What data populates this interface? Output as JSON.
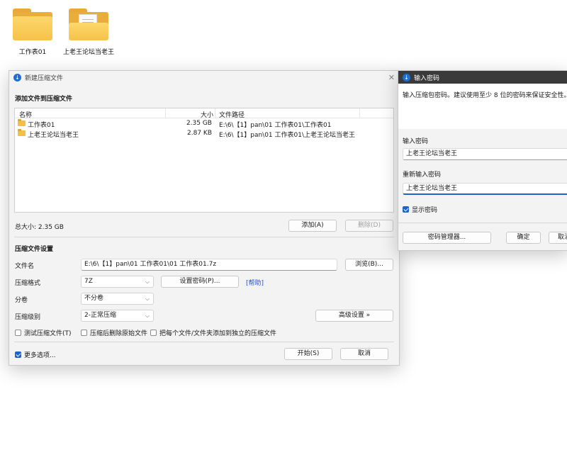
{
  "desktop": {
    "icons": [
      {
        "label": "工作表01"
      },
      {
        "label": "上老王论坛当老王"
      }
    ]
  },
  "main_window": {
    "title": "新建压缩文件",
    "add_section_title": "添加文件到压缩文件",
    "columns": {
      "name": "名称",
      "size": "大小",
      "path": "文件路径"
    },
    "rows": [
      {
        "name": "工作表01",
        "size": "2.35 GB",
        "path": "E:\\6\\【1】pan\\01 工作表01\\工作表01"
      },
      {
        "name": "上老王论坛当老王",
        "size": "2.87 KB",
        "path": "E:\\6\\【1】pan\\01 工作表01\\上老王论坛当老王"
      }
    ],
    "total_size": "总大小: 2.35 GB",
    "add_button": "添加(A)",
    "delete_button": "删除(D)",
    "settings_title": "压缩文件设置",
    "filename_label": "文件名",
    "filename_value": "E:\\6\\【1】pan\\01 工作表01\\01 工作表01.7z",
    "browse_button": "浏览(B)...",
    "format_label": "压缩格式",
    "format_value": "7Z",
    "set_password_button": "设置密码(P)...",
    "help_link": "[帮助]",
    "split_label": "分卷",
    "split_value": "不分卷",
    "level_label": "压缩级别",
    "level_value": "2-正常压缩",
    "advanced_button": "高级设置 »",
    "test_checkbox": "测试压缩文件(T)",
    "delete_after_checkbox": "压缩后删除原始文件",
    "separate_checkbox": "把每个文件/文件夹添加到独立的压缩文件",
    "more_options_checkbox": "更多选项...",
    "start_button": "开始(S)",
    "cancel_button": "取消"
  },
  "password_dialog": {
    "title": "输入密码",
    "description": "输入压缩包密码。建议使用至少 8 位的密码来保证安全性。",
    "enter_label": "输入密码",
    "enter_value": "上老王论坛当老王",
    "reenter_label": "重新输入密码",
    "reenter_value": "上老王论坛当老王",
    "show_password": "显示密码",
    "manager_button": "密码管理器...",
    "ok_button": "确定",
    "cancel_button": "取消"
  },
  "colors": {
    "accent": "#1e63c8",
    "folder": "#f6c24a"
  },
  "icons": [
    "folder-icon",
    "app-logo-icon",
    "close-icon",
    "chevron-down-icon",
    "checkbox-icon"
  ]
}
